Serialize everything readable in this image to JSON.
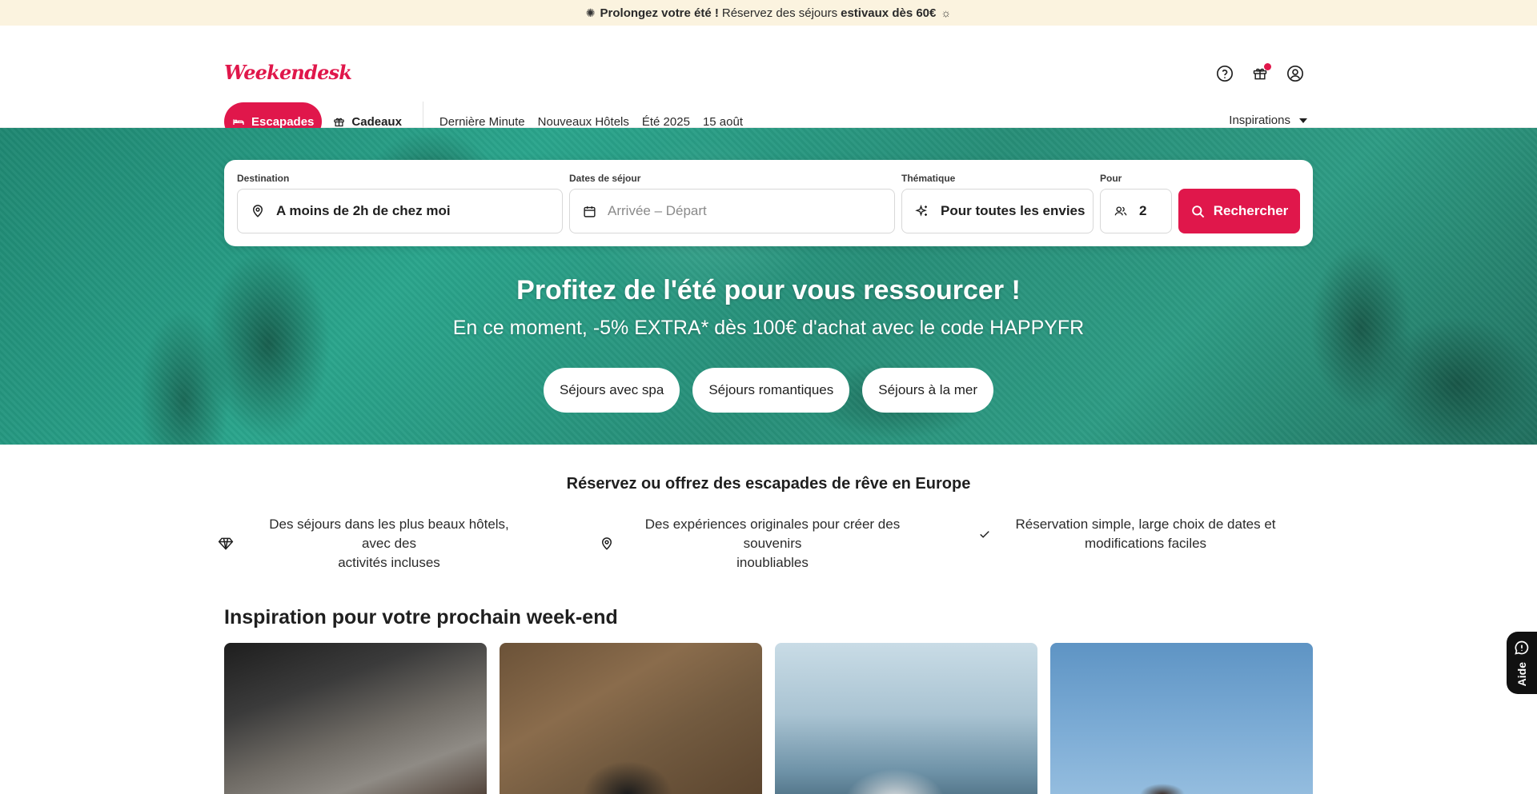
{
  "promo": {
    "bold_left": "Prolongez votre été !",
    "middle": "Réservez des séjours",
    "bold_right": "estivaux dès 60€"
  },
  "brand": {
    "logo_text": "Weekendesk",
    "accent_color": "#e0174b"
  },
  "header_icons": [
    "help-icon",
    "gift-icon",
    "account-icon"
  ],
  "nav": {
    "escapades": "Escapades",
    "cadeaux": "Cadeaux",
    "links": [
      "Dernière Minute",
      "Nouveaux Hôtels",
      "Été 2025",
      "15 août"
    ],
    "inspirations": "Inspirations"
  },
  "search": {
    "destination_label": "Destination",
    "destination_value": "A moins de 2h de chez moi",
    "dates_label": "Dates de séjour",
    "dates_placeholder": "Arrivée – Départ",
    "theme_label": "Thématique",
    "theme_value": "Pour toutes les envies",
    "guests_label": "Pour",
    "guests_value": "2",
    "button": "Rechercher"
  },
  "hero": {
    "title": "Profitez de l'été pour vous ressourcer !",
    "subtitle": "En ce moment, -5% EXTRA* dès 100€ d'achat avec le code HAPPYFR",
    "chips": [
      "Séjours avec spa",
      "Séjours romantiques",
      "Séjours à la mer"
    ]
  },
  "value_props": {
    "title": "Réservez ou offrez des escapades de rêve en Europe",
    "items": [
      {
        "icon": "diamond-icon",
        "line1": "Des séjours dans les plus beaux hôtels, avec des",
        "line2": "activités incluses"
      },
      {
        "icon": "location-pin-icon",
        "line1": "Des expériences originales pour créer des souvenirs",
        "line2": "inoubliables"
      },
      {
        "icon": "checkmark-icon",
        "line1": "Réservation simple, large choix de dates et",
        "line2": "modifications faciles"
      }
    ]
  },
  "inspiration": {
    "title": "Inspiration pour votre prochain week-end"
  },
  "help_tab": {
    "label": "Aide"
  }
}
